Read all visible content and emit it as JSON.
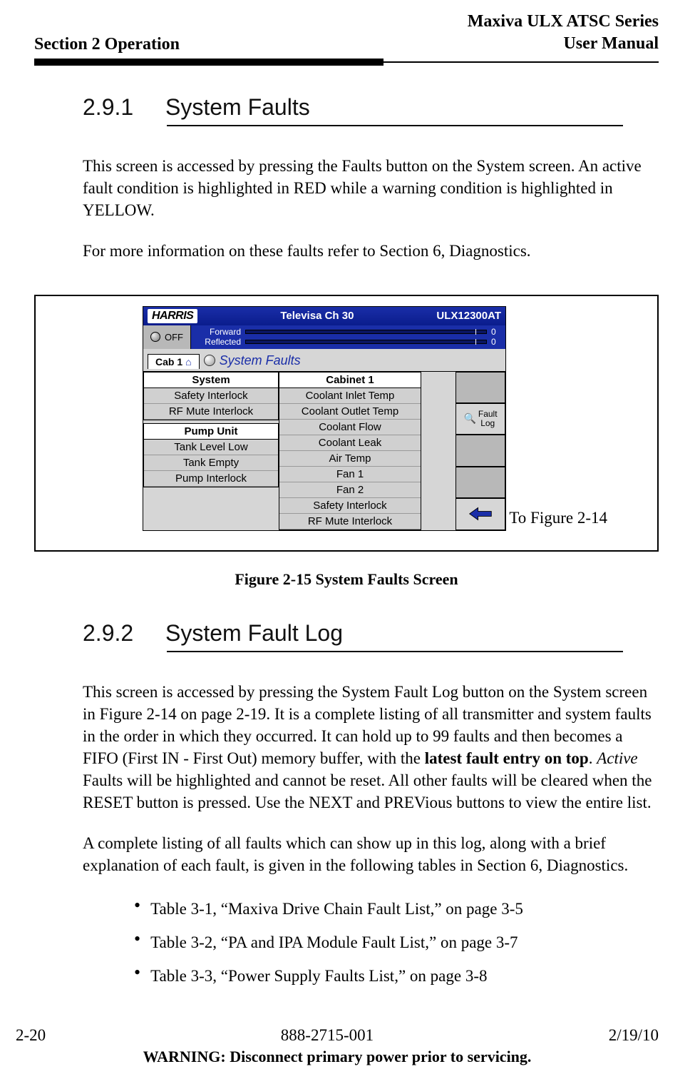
{
  "running_head": {
    "section": "Section 2 Operation",
    "product": "Maxiva ULX ATSC Series",
    "doc": "User Manual"
  },
  "sec1": {
    "number": "2.9.1",
    "title": "System Faults",
    "p1": "This screen is accessed by pressing the Faults button on the System screen. An active fault condition is highlighted in RED while a warning condition is highlighted in YELLOW.",
    "p2": "For more information on these faults refer to Section 6, Diagnostics."
  },
  "figure": {
    "caption": "Figure 2-15  System Faults Screen",
    "annotation": "To Figure 2-14",
    "shot": {
      "brand": "HARRIS",
      "title_mid": "Televisa Ch 30",
      "title_right": "ULX12300AT",
      "off": "OFF",
      "meters": {
        "forward_label": "Forward",
        "forward_val": "0",
        "reflected_label": "Reflected",
        "reflected_val": "0"
      },
      "tab": "Cab 1",
      "screen_title": "System Faults",
      "system_hd": "System",
      "system_items": [
        "Safety Interlock",
        "RF Mute Interlock"
      ],
      "pump_hd": "Pump Unit",
      "pump_items": [
        "Tank Level Low",
        "Tank Empty",
        "Pump Interlock"
      ],
      "cab_hd": "Cabinet 1",
      "cab_items": [
        "Coolant Inlet Temp",
        "Coolant Outlet Temp",
        "Coolant Flow",
        "Coolant Leak",
        "Air Temp",
        "Fan 1",
        "Fan 2",
        "Safety Interlock",
        "RF Mute Interlock"
      ],
      "fault_log_btn": "Fault\nLog"
    }
  },
  "sec2": {
    "number": "2.9.2",
    "title": "System Fault Log",
    "p1a": "This screen is accessed by pressing the System Fault Log button on the System screen in Figure 2-14 on page 2-19. It is a complete listing of all transmitter and system faults in the order in which they occurred. It can hold up to 99 faults and then becomes a FIFO (First IN - First Out) memory buffer, with the ",
    "p1b_strong": "latest fault entry on top",
    "p1c": ". ",
    "p1d_em": "Active",
    "p1e": " Faults will be highlighted and cannot be reset. All other faults will be cleared when the RESET button is pressed. Use the NEXT and PREVious buttons to view the entire list.",
    "p2": "A complete listing of all faults which can show up in this log, along with a brief explanation of each fault, is given in the following tables in Section 6, Diagnostics.",
    "bullets": [
      "Table 3-1, “Maxiva Drive Chain Fault List,” on page 3-5",
      "Table 3-2, “PA and IPA Module Fault List,” on page 3-7",
      "Table 3-3, “Power Supply Faults List,” on page 3-8"
    ]
  },
  "footer": {
    "page": "2-20",
    "docnum": "888-2715-001",
    "date": "2/19/10",
    "warning": "WARNING: Disconnect primary power prior to servicing."
  }
}
